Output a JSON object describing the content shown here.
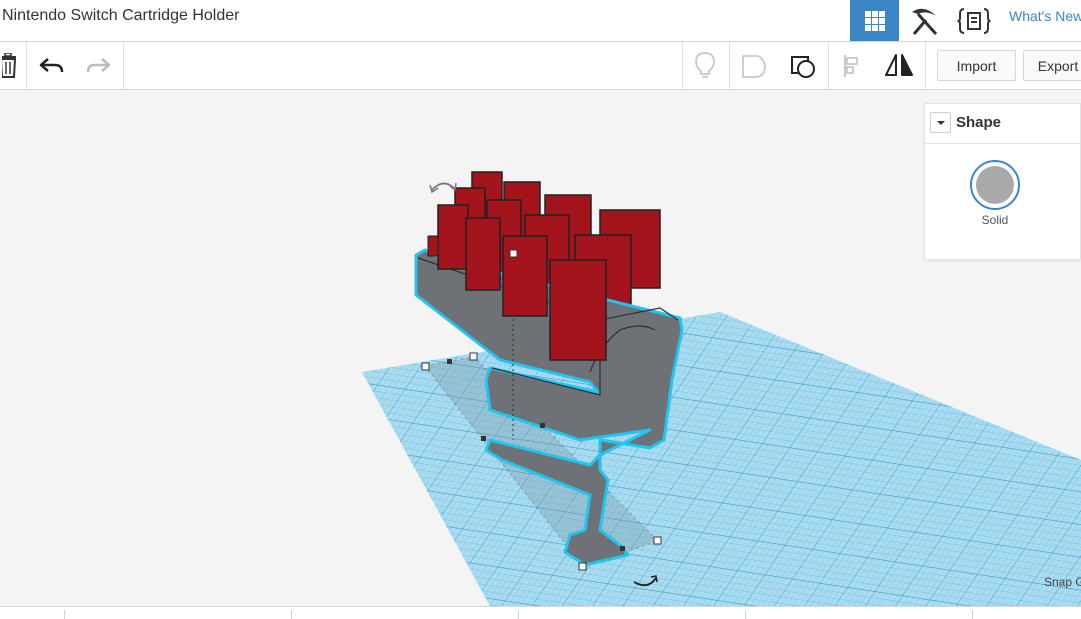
{
  "document": {
    "title": "Nintendo Switch Cartridge Holder"
  },
  "header": {
    "views": [
      {
        "name": "grid-3d-view",
        "icon": "grid-icon",
        "active": true
      },
      {
        "name": "blocks-view",
        "icon": "pickaxe-icon",
        "active": false
      },
      {
        "name": "codeblocks-view",
        "icon": "codeblocks-icon",
        "active": false
      }
    ],
    "whats_new": "What's New"
  },
  "toolbar": {
    "delete_icon": "trash-icon",
    "undo_icon": "undo-icon",
    "redo_icon": "redo-icon",
    "note_icon": "lightbulb-icon",
    "comment_icon": "comment-icon",
    "show_all_icon": "show-all-icon",
    "align_icon": "align-icon",
    "mirror_icon": "mirror-icon",
    "import_label": "Import",
    "export_label": "Export"
  },
  "inspector": {
    "title": "Shape",
    "solid_label": "Solid",
    "solid_color": "#a9a9a9",
    "accent": "#3d86c6"
  },
  "workplane": {
    "snap_label": "Snap G",
    "model_color": "#6e7276",
    "cartridge_color": "#a3141c",
    "grid_color": "#8fd0ea"
  }
}
